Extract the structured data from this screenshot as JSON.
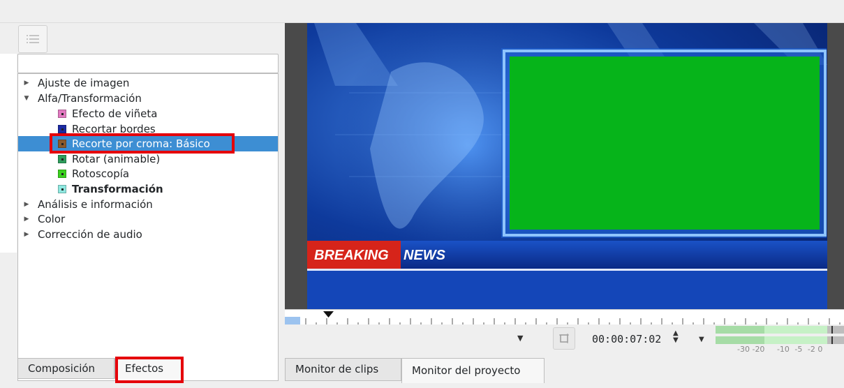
{
  "effects_panel": {
    "search_placeholder": "",
    "tree": [
      {
        "label": "Ajuste de imagen",
        "expanded": false
      },
      {
        "label": "Alfa/Transformación",
        "expanded": true,
        "children": [
          {
            "label": "Efecto de viñeta",
            "color": "#e27ac1"
          },
          {
            "label": "Recortar bordes",
            "color": "#1b2aa3"
          },
          {
            "label": "Recorte por croma: Básico",
            "color": "#8b5a2b",
            "selected": true
          },
          {
            "label": "Rotar (animable)",
            "color": "#2e9d5c"
          },
          {
            "label": "Rotoscopía",
            "color": "#3ad11e"
          },
          {
            "label": "Transformación",
            "color": "#8fe8e0",
            "bold": true
          }
        ]
      },
      {
        "label": "Análisis e información",
        "expanded": false
      },
      {
        "label": "Color",
        "expanded": false
      },
      {
        "label": "Corrección de audio",
        "expanded": false
      }
    ],
    "tabs": [
      "Composición",
      "Efectos"
    ]
  },
  "monitor": {
    "breaking": "BREAKING",
    "news": "NEWS",
    "timecode": "00:00:07:02",
    "meter_scale": [
      "-30",
      "-20",
      "-10",
      "-5",
      "-2",
      "0"
    ],
    "tabs": [
      "Monitor de clips",
      "Monitor del proyecto"
    ]
  }
}
